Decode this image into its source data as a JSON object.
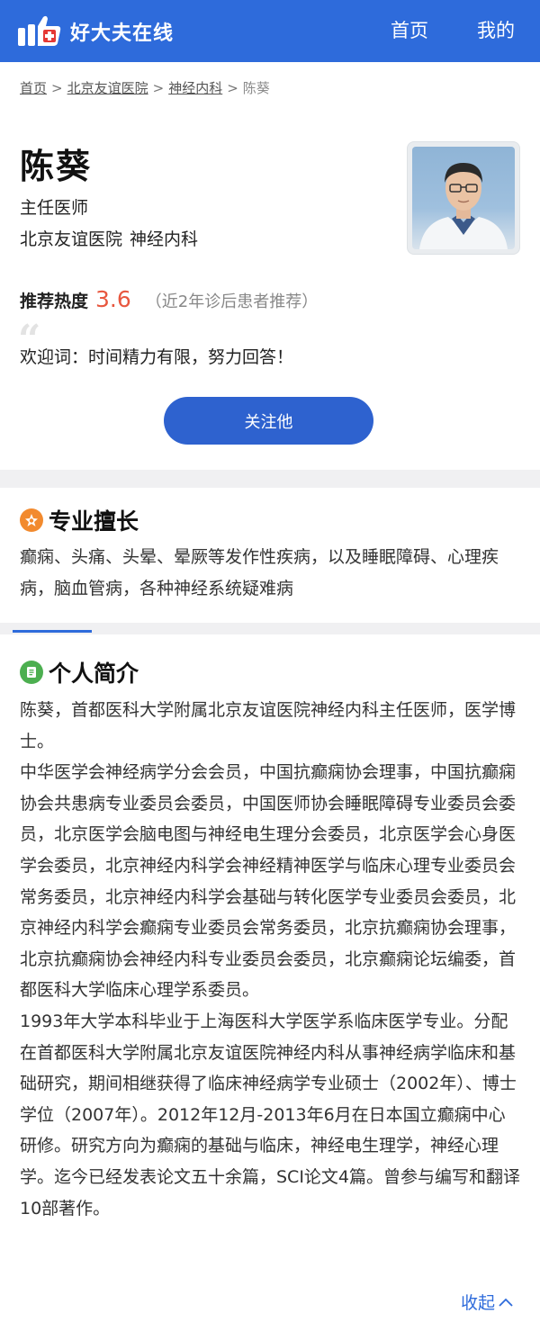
{
  "header": {
    "logo_text": "好大夫在线",
    "nav_home": "首页",
    "nav_mine": "我的",
    "brand_color": "#2e6bdb"
  },
  "breadcrumb": {
    "home": "首页",
    "hospital": "北京友谊医院",
    "department": "神经内科",
    "current": "陈葵",
    "separator": ">"
  },
  "doctor": {
    "name": "陈葵",
    "title": "主任医师",
    "hospital": "北京友谊医院",
    "department": "神经内科"
  },
  "recommendation": {
    "label": "推荐热度",
    "score": "3.6",
    "note": "（近2年诊后患者推荐）",
    "score_color": "#e8573f"
  },
  "welcome": {
    "quote_icon": "quote-icon",
    "text": "欢迎词：时间精力有限，努力回答！"
  },
  "follow_button": "关注他",
  "specialty": {
    "heading": "专业擅长",
    "icon": "specialty-icon",
    "text": "癫痫、头痛、头晕、晕厥等发作性疾病，以及睡眠障碍、心理疾病，脑血管病，各种神经系统疑难病"
  },
  "bio": {
    "heading": "个人简介",
    "icon": "profile-doc-icon",
    "paragraphs": [
      "陈葵，首都医科大学附属北京友谊医院神经内科主任医师，医学博士。",
      "中华医学会神经病学分会会员，中国抗癫痫协会理事，中国抗癫痫协会共患病专业委员会委员，中国医师协会睡眠障碍专业委员会委员，北京医学会脑电图与神经电生理分会委员，北京医学会心身医学会委员，北京神经内科学会神经精神医学与临床心理专业委员会常务委员，北京神经内科学会基础与转化医学专业委员会委员，北京神经内科学会癫痫专业委员会常务委员，北京抗癫痫协会理事，北京抗癫痫协会神经内科专业委员会委员，北京癫痫论坛编委，首都医科大学临床心理学系委员。",
      "1993年大学本科毕业于上海医科大学医学系临床医学专业。分配在首都医科大学附属北京友谊医院神经内科从事神经病学临床和基础研究，期间相继获得了临床神经病学专业硕士（2002年）、博士学位（2007年）。2012年12月-2013年6月在日本国立癫痫中心研修。研究方向为癫痫的基础与临床，神经电生理学，神经心理学。迄今已经发表论文五十余篇，SCI论文4篇。曾参与编写和翻译10部著作。"
    ],
    "collapse_label": "收起"
  }
}
